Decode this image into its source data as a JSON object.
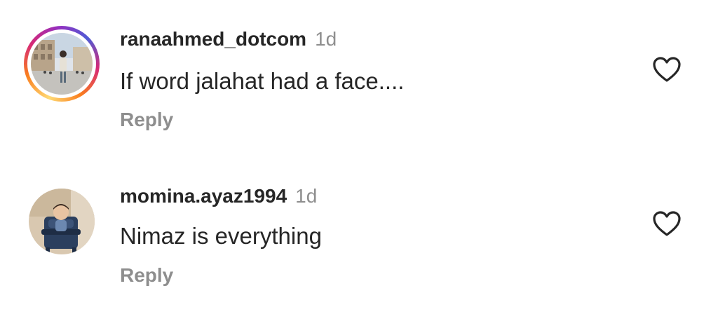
{
  "comments": [
    {
      "username": "ranaahmed_dotcom",
      "time": "1d",
      "text": "If word jalahat had a face....",
      "reply_label": "Reply",
      "avatar_ring": true,
      "liked": false
    },
    {
      "username": "momina.ayaz1994",
      "time": "1d",
      "text": "Nimaz is everything",
      "reply_label": "Reply",
      "avatar_ring": false,
      "liked": false
    }
  ],
  "icons": {
    "like": "heart-outline-icon"
  },
  "colors": {
    "text": "#262626",
    "muted": "#8e8e8e",
    "story_ring": [
      "#feda75",
      "#fa7e1e",
      "#d62976",
      "#962fbf",
      "#4f5bd5"
    ]
  }
}
